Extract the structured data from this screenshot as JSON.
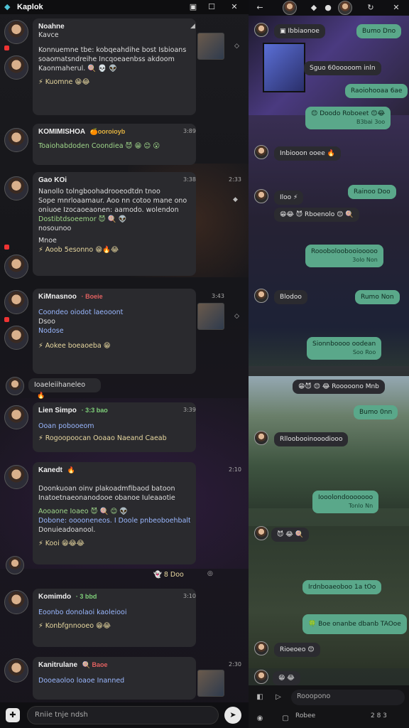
{
  "window": {
    "app_title": "Kaplok",
    "tab_icon": "tab-icon",
    "maximize_icon": "maximize-icon",
    "close_icon": "close-icon"
  },
  "left_feed": {
    "messages": [
      {
        "name": "Noahne",
        "time": "",
        "lines": [
          "Kavce",
          "Konnuemne tbe: kobqeahdihe bost Isbioans",
          "soaomatsndreihe Incqoeaenbss akdoom",
          "Kaonmaherul. 🍭 💀 👽"
        ],
        "reactions": "⚡ Kuomne 😁😂"
      },
      {
        "name": "KOMIMISHOA",
        "tag": "🍊ooroioyb",
        "time": "3:89",
        "lines": [
          "Toaiohabdoden Coondiea 😈 😁 😊 😮"
        ],
        "reactions": ""
      },
      {
        "name": "Gao KOi",
        "time": "3:38",
        "time2": "2:33",
        "lines": [
          "Nanollo  tolngboohadrooeodtdn tnoo",
          "Sope  mnrloaamaur. Aoo nn cotoo mane  ono",
          "oniuoe  Izocaoeaonen:  aamodo.  wolendon",
          "Dostibtdsoeemor  😈 🍭 👽"
        ],
        "line_extra": "nosounoo",
        "sub": "Mnoe",
        "reactions": "⚡ Aoob 5esonno 😁🔥😂"
      },
      {
        "name": "KiMnasnoo",
        "tag": "· Boeie",
        "time": "3:43",
        "lines": [
          "Coondeo oiodot laeooont",
          "Dsoo",
          "Nodose"
        ],
        "reactions": "⚡ Aokee  boeaoeba 😁"
      },
      {
        "name": "Ioaeleiihaneleo",
        "tag": "🔥",
        "time": "",
        "lines": [],
        "reactions": ""
      },
      {
        "name": "Lien Simpo",
        "tag": "· 3:3 bao",
        "time": "3:39",
        "lines": [
          "Ooan pobooeom"
        ],
        "reactions": "⚡ Rogoopoocan Ooaao Naeand Caeab"
      },
      {
        "name": "Kanedt",
        "tag": "🔥",
        "time": "2:10",
        "lines": [
          "Doonkuoan oinv plakoadmfibaod  batoon",
          "Inatoetnaeonanodooe obanoe Iuleaaotie",
          "Aooaone Ioaeo 😈 🍭 😊 👽",
          "Dobone: ooooneneos. I Doole  pnbeoboehbalt",
          "Donuieadoanool."
        ],
        "reactions": "⚡ Kooi 😁😂😂"
      },
      {
        "name": "",
        "time": "",
        "lines": [],
        "reactions": "👻 8  Doo"
      },
      {
        "name": "Komimdo",
        "tag": "· 3 bbd",
        "time": "3:10",
        "lines": [
          "Eoonbo donolaoi kaoleiooi"
        ],
        "reactions": "⚡ Konbfgnnooeo 😁😂"
      },
      {
        "name": "Kanitrulane",
        "tag": "🍭 Baoe",
        "time": "2:30",
        "lines": [
          "Dooeaoloo loaoe Inanned"
        ],
        "reactions": ""
      }
    ]
  },
  "left_composer": {
    "placeholder": "Rniie tnje ndsh",
    "plus_icon": "plus-icon",
    "send_icon": "send-icon"
  },
  "right_chat": {
    "bubbles": [
      {
        "side": "in",
        "text": "Ibbiaonoe",
        "icon": "image-icon"
      },
      {
        "side": "out",
        "text": "Bumo Dno"
      },
      {
        "side": "in",
        "text": "Sguo 60ooooom inln"
      },
      {
        "side": "out",
        "text": "Raoiohooaa 6ae"
      },
      {
        "side": "out",
        "text": "😊 Doodo Roboeet 😊😂",
        "sub": "B3bai 3oo"
      },
      {
        "side": "in",
        "text": "Inbiooon ooee 🔥"
      },
      {
        "side": "out",
        "text": "Rainoo Doo"
      },
      {
        "side": "in",
        "text": "Iloo ⚡"
      },
      {
        "side": "in",
        "text": "😁😂 😈 Rboenolo 😊 🍭"
      },
      {
        "side": "out",
        "text": "Roooboloobooiooooo",
        "sub": "3olo Non"
      },
      {
        "side": "in",
        "text": "Blodoo"
      },
      {
        "side": "out",
        "text": "Rumo Non"
      },
      {
        "side": "out",
        "text": "Sionnboooo oodean",
        "sub": "Soo Roo"
      },
      {
        "side": "in",
        "text": "😁😈 😊 😂 Rooooono Mnb"
      },
      {
        "side": "out",
        "text": "Bumo 0nn"
      },
      {
        "side": "in",
        "text": "Rlloobooinooodiooo"
      },
      {
        "side": "out",
        "text": "Iooolondooooooo",
        "sub": "Tonlo Nn"
      },
      {
        "side": "in",
        "text": "😈 😂 🍭"
      },
      {
        "side": "out",
        "text": "Irdnboaeoboo 1a tOo"
      },
      {
        "side": "out",
        "text": "🍀 Boe onanbe dbanb TAOoe"
      },
      {
        "side": "in",
        "text": "Rioeoeo 😊"
      },
      {
        "side": "in",
        "text": "😁 😂"
      }
    ]
  },
  "right_composer": {
    "placeholder": "Rooopono",
    "attach_label": "Robee",
    "counter": "2 8 3",
    "icons": [
      "sticker-icon",
      "play-icon",
      "emoji-icon",
      "attach-icon"
    ]
  }
}
